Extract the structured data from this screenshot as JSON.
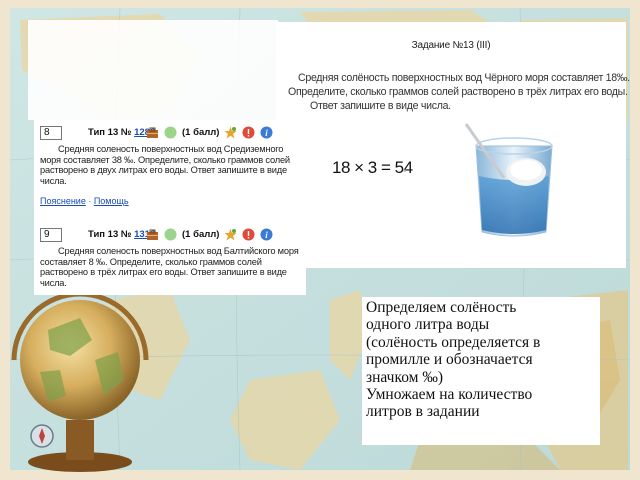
{
  "task_card": {
    "title": "Задание №13 (III)",
    "lines": [
      "Средняя солёность поверхностных вод Чёрного моря составляет 18‰.",
      "Определите, сколько граммов солей растворено в трёх литрах его воды.",
      "Ответ запишите в виде числа."
    ],
    "calculation": "18 × 3 = 54"
  },
  "problems": [
    {
      "number": "8",
      "type_prefix": "Тип 13 № ",
      "type_number": "1286",
      "points": "(1 балл)",
      "text": "Средняя соленость поверхностных вод Средиземного моря составляет 38 ‰. Определите, сколько граммов солей растворено в двух литрах его воды. Ответ запишите в виде числа.",
      "links": [
        "Пояснение",
        "Помощь"
      ]
    },
    {
      "number": "9",
      "type_prefix": "Тип 13 № ",
      "type_number": "1316",
      "points": "(1 балл)",
      "text": "Средняя соленость поверхностных вод Балтийского моря составляет 8 ‰. Определите, сколько граммов солей растворено в трёх литрах его воды. Ответ запишите в виде числа."
    }
  ],
  "explanation": {
    "lines": [
      "Определяем солёность",
      "одного литра воды",
      "(солёность определяется в",
      "промилле  и обозначается",
      "значком ‰)",
      "Умножаем на количество",
      "литров в задании"
    ]
  },
  "colors": {
    "link": "#1a4db0",
    "background_frame": "#f4ead6"
  },
  "icons": [
    "briefcase-icon",
    "green-dot-icon",
    "star-icon",
    "alert-icon",
    "info-icon",
    "globe-icon",
    "glass-of-water-icon"
  ]
}
